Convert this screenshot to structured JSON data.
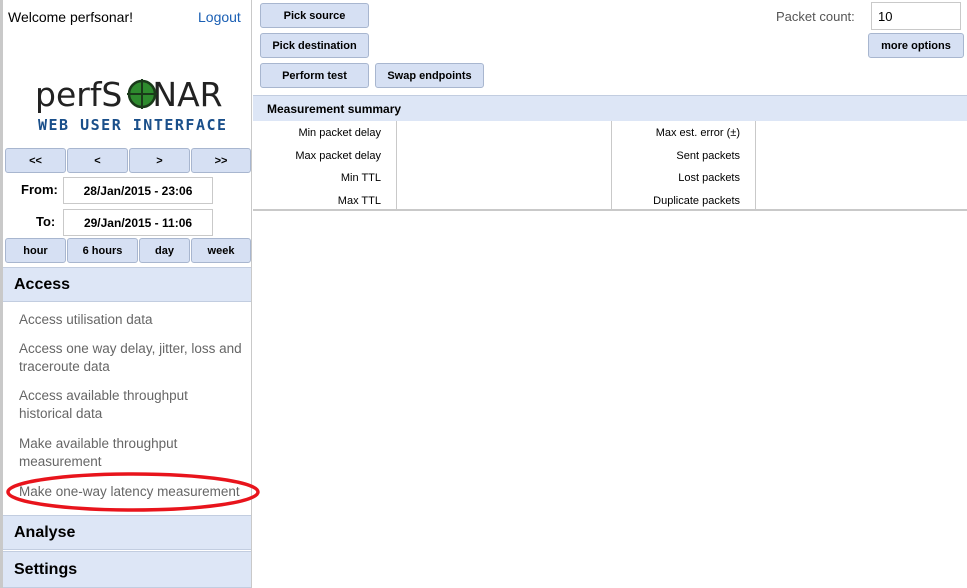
{
  "header": {
    "welcome": "Welcome perfsonar!",
    "logout": "Logout"
  },
  "logo": {
    "title_part1": "perfS",
    "title_part2": "NAR",
    "subtitle": "WEB USER INTERFACE"
  },
  "nav": {
    "first": "<<",
    "prev": "<",
    "next": ">",
    "last": ">>"
  },
  "range": {
    "from_label": "From:",
    "from_value": "28/Jan/2015 - 23:06",
    "to_label": "To:",
    "to_value": "29/Jan/2015 - 11:06"
  },
  "periods": [
    "hour",
    "6 hours",
    "day",
    "week"
  ],
  "sections": {
    "access": {
      "title": "Access",
      "items": [
        "Access utilisation data",
        "Access one way delay, jitter, loss and traceroute data",
        "Access available throughput historical data",
        "Make available throughput measurement",
        "Make one-way latency measurement"
      ]
    },
    "analyse": {
      "title": "Analyse"
    },
    "settings": {
      "title": "Settings"
    }
  },
  "toolbar": {
    "pick_source": "Pick source",
    "pick_destination": "Pick destination",
    "perform_test": "Perform test",
    "swap_endpoints": "Swap endpoints",
    "packet_count_label": "Packet count:",
    "packet_count_value": "10",
    "more_options": "more options"
  },
  "summary": {
    "title": "Measurement summary",
    "left_labels": [
      "Min packet delay",
      "Max packet delay",
      "Min TTL",
      "Max TTL"
    ],
    "right_labels": [
      "Max est. error (±)",
      "Sent packets",
      "Lost packets",
      "Duplicate packets"
    ]
  },
  "colors": {
    "accent_bg": "#dde6f6",
    "button_bg": "#d6e0f3",
    "highlight_ellipse": "#e8141c",
    "logo_green": "#2e8b2e",
    "logo_blue": "#1a4f8a"
  }
}
